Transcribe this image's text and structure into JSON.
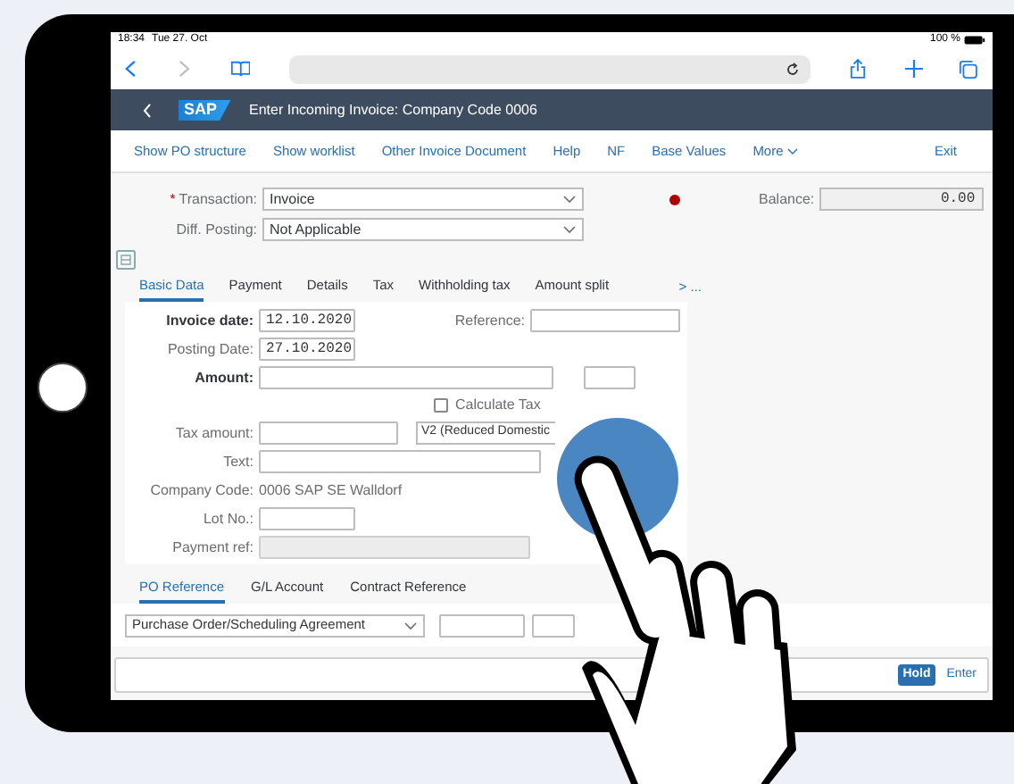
{
  "status_bar": {
    "time": "18:34",
    "date": "Tue 27. Oct",
    "battery": "100 %"
  },
  "app_header": {
    "logo": "SAP",
    "title": "Enter Incoming Invoice: Company Code 0006"
  },
  "toolbar": {
    "items": [
      {
        "label": "Show PO structure"
      },
      {
        "label": "Show worklist"
      },
      {
        "label": "Other Invoice Document"
      },
      {
        "label": "Help"
      },
      {
        "label": "NF"
      },
      {
        "label": "Base Values"
      }
    ],
    "more": "More",
    "exit": "Exit"
  },
  "header_fields": {
    "transaction": {
      "required_mark": "*",
      "label": "Transaction:",
      "value": "Invoice"
    },
    "diff_posting": {
      "label": "Diff. Posting:",
      "value": "Not Applicable"
    },
    "balance": {
      "label": "Balance:",
      "value": "0.00"
    }
  },
  "tabs": [
    {
      "label": "Basic Data",
      "selected": true
    },
    {
      "label": "Payment",
      "selected": false
    },
    {
      "label": "Details",
      "selected": false
    },
    {
      "label": "Tax",
      "selected": false
    },
    {
      "label": "Withholding tax",
      "selected": false
    },
    {
      "label": "Amount split",
      "selected": false
    }
  ],
  "tabs_more": {
    "arrow": ">",
    "ellipsis": "..."
  },
  "basic_data": {
    "invoice_date": {
      "label": "Invoice date:",
      "value": "12.10.2020"
    },
    "reference": {
      "label": "Reference:"
    },
    "posting_date": {
      "label": "Posting Date:",
      "value": "27.10.2020"
    },
    "amount": {
      "label": "Amount:"
    },
    "calculate_tax": {
      "label": "Calculate Tax",
      "checked": false
    },
    "tax_amount": {
      "label": "Tax amount:"
    },
    "tax_code": {
      "value": "V2 (Reduced Domestic"
    },
    "text": {
      "label": "Text:"
    },
    "company_code": {
      "label": "Company Code:",
      "value": "0006 SAP SE Walldorf"
    },
    "lot_no": {
      "label": "Lot No.:"
    },
    "payment_ref": {
      "label": "Payment ref:",
      "disabled": true
    }
  },
  "lower_tabs": [
    {
      "label": "PO Reference",
      "selected": true
    },
    {
      "label": "G/L Account",
      "selected": false
    },
    {
      "label": "Contract Reference",
      "selected": false
    }
  ],
  "po_reference": {
    "document_type": "Purchase Order/Scheduling Agreement"
  },
  "footer_buttons": [
    {
      "label": "Hold",
      "kind": "emphasized"
    },
    {
      "label": "Enter",
      "kind": "transparent"
    }
  ]
}
